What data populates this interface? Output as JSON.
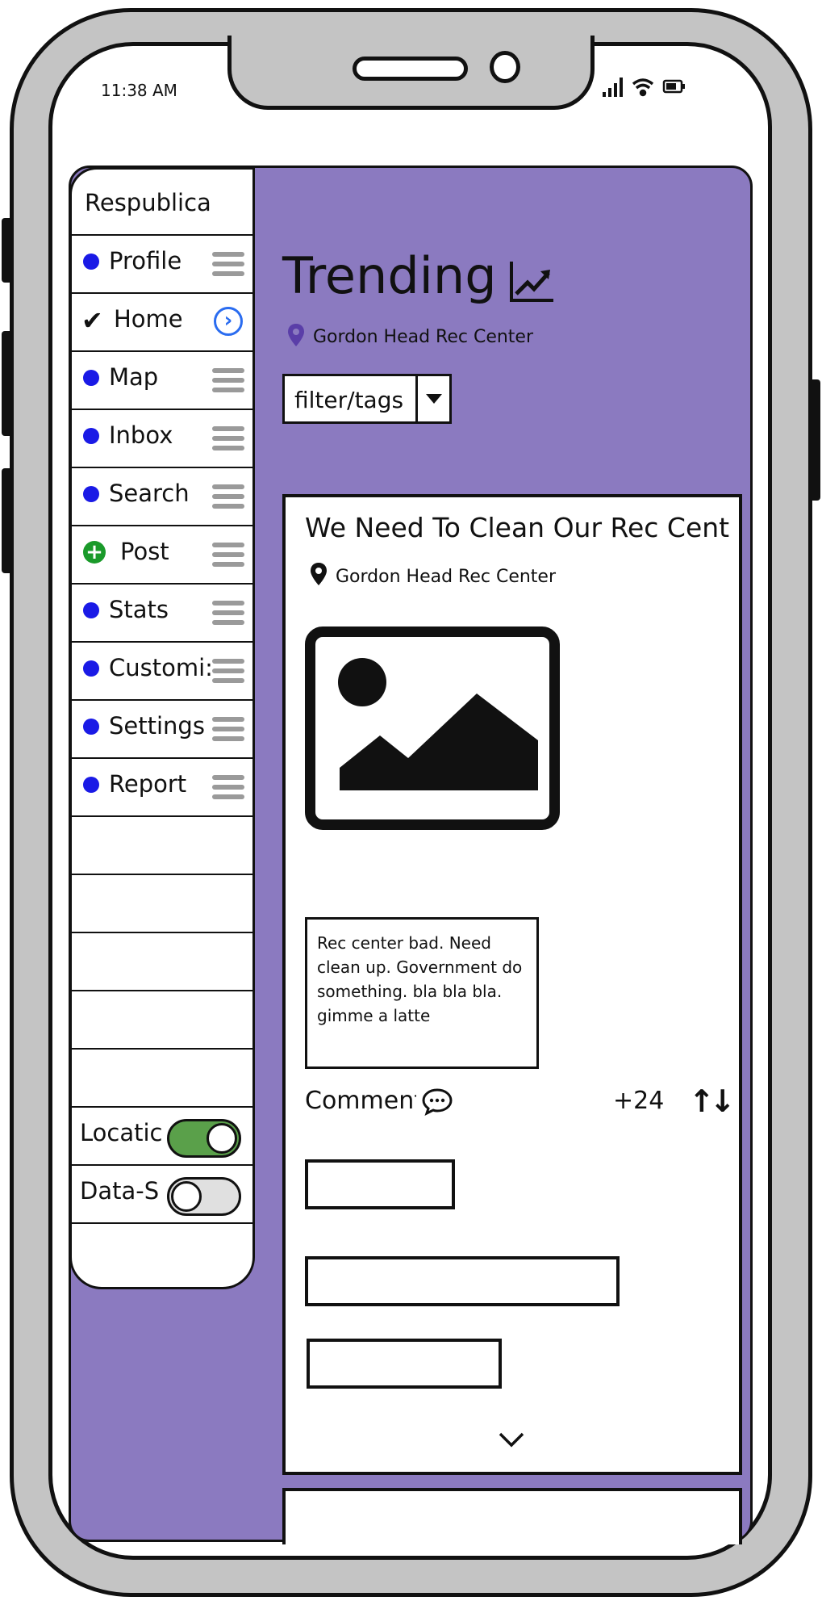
{
  "status_bar": {
    "time": "11:38 AM",
    "icons": [
      "signal-icon",
      "wifi-icon",
      "battery-icon"
    ]
  },
  "sidebar": {
    "brand": "Respublica",
    "items": [
      {
        "label": "Profile",
        "state": "default"
      },
      {
        "label": "Home",
        "state": "selected"
      },
      {
        "label": "Map",
        "state": "default"
      },
      {
        "label": "Inbox",
        "state": "default"
      },
      {
        "label": "Search",
        "state": "default"
      },
      {
        "label": "Post",
        "state": "add"
      },
      {
        "label": "Stats",
        "state": "default"
      },
      {
        "label": "Customi:",
        "state": "default"
      },
      {
        "label": "Settings",
        "state": "default"
      },
      {
        "label": "Report",
        "state": "default"
      }
    ],
    "toggles": [
      {
        "label": "Locatic",
        "on": true
      },
      {
        "label": "Data-S",
        "on": false
      }
    ]
  },
  "header": {
    "title": "Trending",
    "location": "Gordon Head Rec Center",
    "filter_label": "filter/tags"
  },
  "post": {
    "title": "We Need To Clean Our Rec Cent",
    "location": "Gordon Head Rec Center",
    "body": "Rec center bad. Need clean up. Government do something. bla bla bla. gimme a latte",
    "comments_label": "Comments",
    "vote_count": "+24"
  },
  "colors": {
    "panel": "#8b7ac0",
    "accent_blue": "#1a1ae6",
    "toggle_on": "#5aa04a",
    "pin": "#5a3ea8"
  }
}
